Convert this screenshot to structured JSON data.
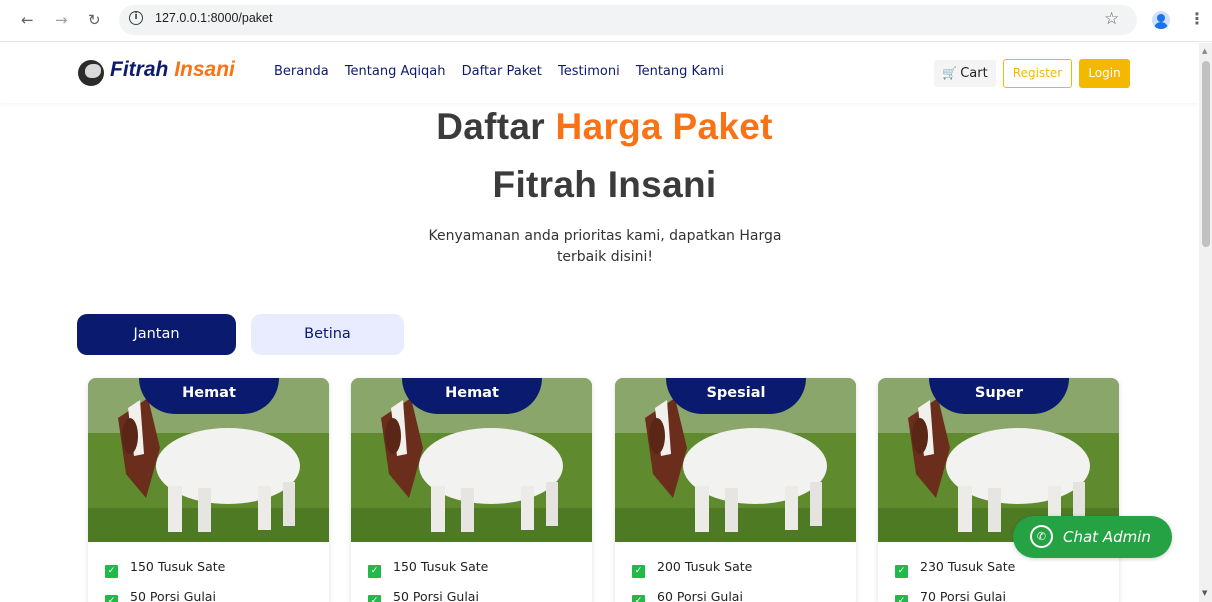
{
  "browser": {
    "url": "127.0.0.1:8000/paket",
    "icons": [
      "back-icon",
      "forward-icon",
      "reload-icon",
      "info-icon",
      "star-icon",
      "profile-icon",
      "kebab-menu-icon"
    ]
  },
  "navbar": {
    "brand_part1": "Fitrah",
    "brand_part2": "Insani",
    "menu": [
      "Beranda",
      "Tentang Aqiqah",
      "Daftar Paket",
      "Testimoni",
      "Tentang Kami"
    ],
    "cart_label": "Cart",
    "register_label": "Register",
    "login_label": "Login"
  },
  "hero": {
    "title_dark": "Daftar",
    "title_orange": "Harga Paket",
    "title_line2": "Fitrah Insani",
    "subtitle_line1": "Kenyamanan anda prioritas kami, dapatkan Harga",
    "subtitle_line2": "terbaik disini!"
  },
  "tabs": {
    "jantan": "Jantan",
    "betina": "Betina",
    "active": "Jantan"
  },
  "cards": [
    {
      "badge": "Hemat",
      "features": [
        "150 Tusuk Sate",
        "50 Porsi Gulai"
      ]
    },
    {
      "badge": "Hemat",
      "features": [
        "150 Tusuk Sate",
        "50 Porsi Gulai"
      ]
    },
    {
      "badge": "Spesial",
      "features": [
        "200 Tusuk Sate",
        "60 Porsi Gulai"
      ]
    },
    {
      "badge": "Super",
      "features": [
        "230 Tusuk Sate",
        "70 Porsi Gulai"
      ]
    }
  ],
  "chat": {
    "label": "Chat Admin"
  },
  "colors": {
    "navy": "#0a1a6e",
    "orange": "#f97316",
    "yellow": "#f5b800",
    "green": "#25a244"
  }
}
